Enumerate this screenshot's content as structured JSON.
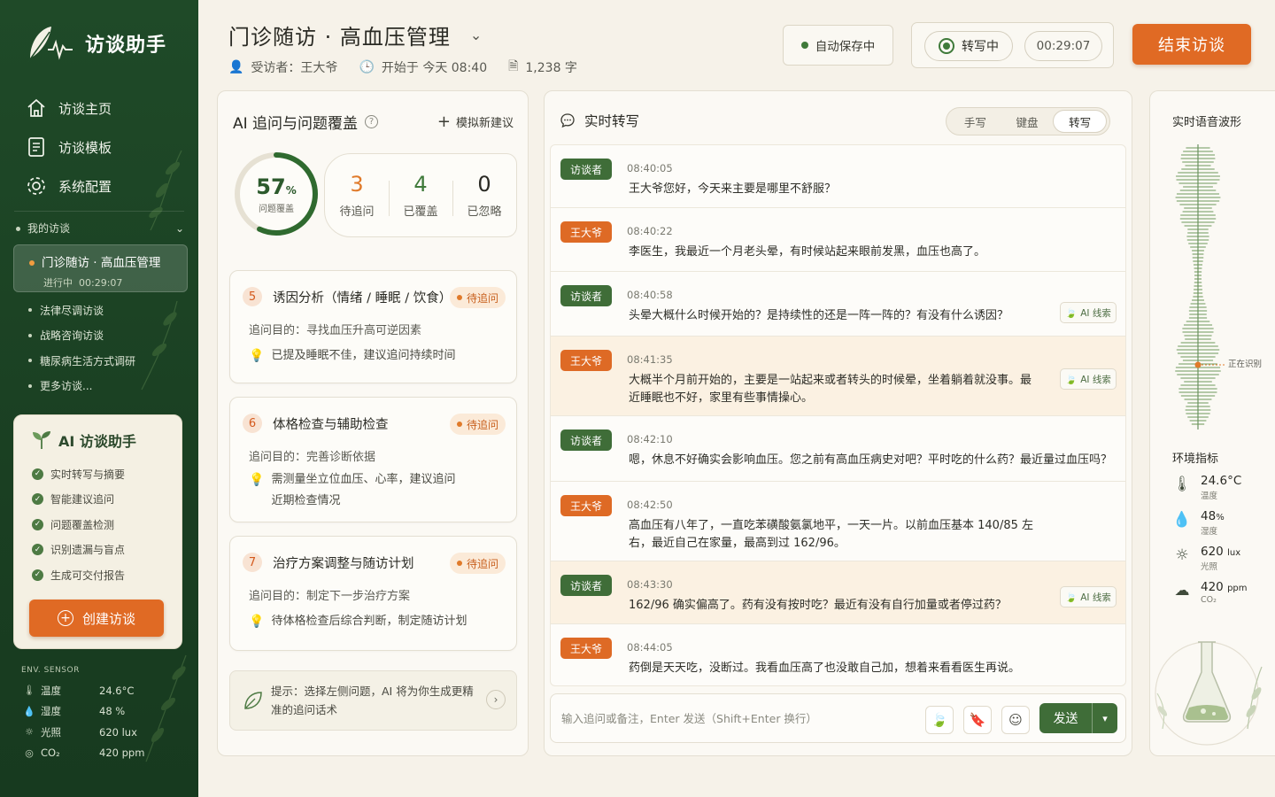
{
  "app": {
    "name": "访谈助手"
  },
  "nav": [
    {
      "label": "访谈主页",
      "icon": "home-icon"
    },
    {
      "label": "访谈模板",
      "icon": "template-icon"
    },
    {
      "label": "系统配置",
      "icon": "gear-icon"
    }
  ],
  "sessions": {
    "group_label": "我的访谈",
    "active": {
      "title": "门诊随访 · 高血压管理",
      "status": "进行中",
      "duration": "00:29:07"
    },
    "items": [
      "法律尽调访谈",
      "战略咨询访谈",
      "糖尿病生活方式调研",
      "更多访谈..."
    ]
  },
  "ai_card": {
    "title": "AI 访谈助手",
    "features": [
      "实时转写与摘要",
      "智能建议追问",
      "问题覆盖检测",
      "识别遗漏与盲点",
      "生成可交付报告"
    ],
    "create_label": "创建访谈"
  },
  "sidebar_env": {
    "title": "ENV. SENSOR",
    "rows": [
      {
        "icon": "thermometer-icon",
        "label": "温度",
        "value": "24.6°C"
      },
      {
        "icon": "humidity-icon",
        "label": "湿度",
        "value": "48 %"
      },
      {
        "icon": "sun-icon",
        "label": "光照",
        "value": "620 lux"
      },
      {
        "icon": "co2-icon",
        "label": "CO₂",
        "value": "420 ppm"
      }
    ]
  },
  "header": {
    "title": "门诊随访 · 高血压管理",
    "interviewee": "受访者：王大爷",
    "started": "开始于 今天 08:40",
    "word_count": "1,238 字",
    "autosave": "自动保存中",
    "recording": "转写中",
    "timer": "00:29:07",
    "end_label": "结束访谈"
  },
  "left_panel": {
    "title": "AI 追问与问题覆盖",
    "simulate_label": "模拟新建议",
    "coverage": {
      "percent": 57,
      "percent_text": "57",
      "unit": "%",
      "label": "问题覆盖"
    },
    "stats": [
      {
        "value": "3",
        "label": "待追问",
        "color": "#e07a2a"
      },
      {
        "value": "4",
        "label": "已覆盖",
        "color": "#3f7a3a"
      },
      {
        "value": "0",
        "label": "已忽略",
        "color": "#2a2a24"
      }
    ],
    "questions": [
      {
        "num": "5",
        "title": "诱因分析（情绪 / 睡眠 / 饮食）",
        "tag": "待追问",
        "purpose": "追问目的：寻找血压升高可逆因素",
        "note": "已提及睡眠不佳，建议追问持续时间"
      },
      {
        "num": "6",
        "title": "体格检查与辅助检查",
        "tag": "待追问",
        "purpose": "追问目的：完善诊断依据",
        "note": "需测量坐立位血压、心率，建议追问近期检查情况"
      },
      {
        "num": "7",
        "title": "治疗方案调整与随访计划",
        "tag": "待追问",
        "purpose": "追问目的：制定下一步治疗方案",
        "note": "待体格检查后综合判断，制定随访计划"
      }
    ],
    "tip": "提示：选择左侧问题，AI 将为你生成更精准的追问话术"
  },
  "transcript": {
    "title": "实时转写",
    "modes": [
      "手写",
      "键盘",
      "转写"
    ],
    "active_mode": "转写",
    "clue_label": "AI 线索",
    "messages": [
      {
        "speaker": "访谈者",
        "role": "i",
        "time": "08:40:05",
        "text": "王大爷您好，今天来主要是哪里不舒服？",
        "clue": false,
        "highlight": false
      },
      {
        "speaker": "王大爷",
        "role": "p",
        "time": "08:40:22",
        "text": "李医生，我最近一个月老头晕，有时候站起来眼前发黑，血压也高了。",
        "clue": false,
        "highlight": false
      },
      {
        "speaker": "访谈者",
        "role": "i",
        "time": "08:40:58",
        "text": "头晕大概什么时候开始的？是持续性的还是一阵一阵的？有没有什么诱因？",
        "clue": true,
        "highlight": false
      },
      {
        "speaker": "王大爷",
        "role": "p",
        "time": "08:41:35",
        "text": "大概半个月前开始的，主要是一站起来或者转头的时候晕，坐着躺着就没事。最近睡眠也不好，家里有些事情操心。",
        "clue": true,
        "highlight": true
      },
      {
        "speaker": "访谈者",
        "role": "i",
        "time": "08:42:10",
        "text": "嗯，休息不好确实会影响血压。您之前有高血压病史对吧？平时吃的什么药？最近量过血压吗？",
        "clue": false,
        "highlight": false
      },
      {
        "speaker": "王大爷",
        "role": "p",
        "time": "08:42:50",
        "text": "高血压有八年了，一直吃苯磺酸氨氯地平，一天一片。以前血压基本 140/85 左右，最近自己在家量，最高到过 162/96。",
        "clue": false,
        "highlight": false
      },
      {
        "speaker": "访谈者",
        "role": "i",
        "time": "08:43:30",
        "text": "162/96 确实偏高了。药有没有按时吃？最近有没有自行加量或者停过药？",
        "clue": true,
        "highlight": true
      },
      {
        "speaker": "王大爷",
        "role": "p",
        "time": "08:44:05",
        "text": "药倒是天天吃，没断过。我看血压高了也没敢自己加，想着来看看医生再说。",
        "clue": false,
        "highlight": false
      }
    ],
    "composer_placeholder": "输入追问或备注，Enter 发送（Shift+Enter 换行）",
    "send_label": "发送"
  },
  "right_panel": {
    "waveform_title": "实时语音波形",
    "recognizing": "正在识别",
    "env_title": "环境指标",
    "metrics": [
      {
        "icon": "thermometer-icon",
        "value": "24.6",
        "unit": "°C",
        "label": "温度"
      },
      {
        "icon": "humidity-icon",
        "value": "48",
        "unit": "%",
        "label": "湿度"
      },
      {
        "icon": "sun-icon",
        "value": "620",
        "unit": "lux",
        "label": "光照"
      },
      {
        "icon": "co2-icon",
        "value": "420",
        "unit": "ppm",
        "label": "CO₂"
      }
    ]
  }
}
